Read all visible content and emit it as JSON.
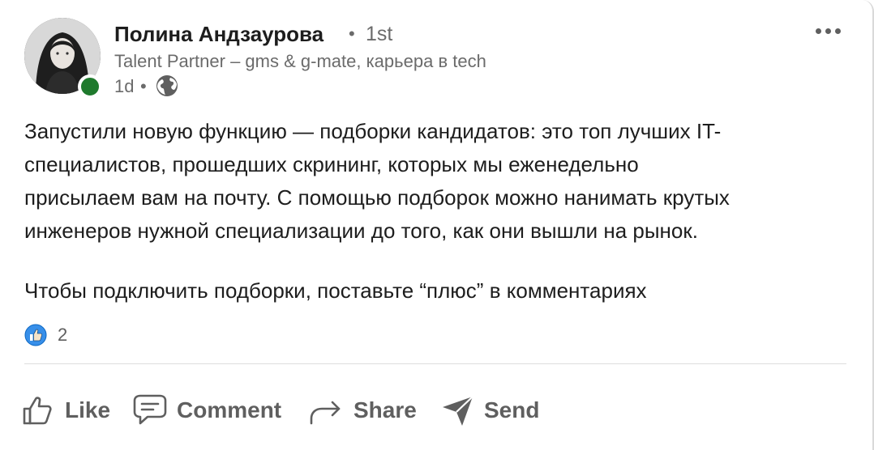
{
  "author": {
    "name": "Полина Андзаурова",
    "degree_separator": "•",
    "degree": "1st",
    "headline": "Talent Partner – gms & g-mate, карьера в tech",
    "time": "1d",
    "time_separator": "•",
    "visibility_icon": "globe-icon",
    "online_status_color": "#1f7a2d"
  },
  "post": {
    "lines": [
      "Запустили новую функцию — подборки кандидатов: это топ лучших IT-",
      "специалистов, прошедших скрининг, которых мы еженедельно",
      "присылаем вам на почту. С помощью подборок можно нанимать крутых",
      "инженеров нужной специализации до того, как они вышли на рынок."
    ],
    "cta": "Чтобы подключить подборки, поставьте “плюс” в комментариях"
  },
  "reactions": {
    "icon": "like-reaction-icon",
    "count": "2",
    "accent": "#378fe9"
  },
  "actions": {
    "like": "Like",
    "comment": "Comment",
    "share": "Share",
    "send": "Send"
  },
  "colors": {
    "text": "#1d1d1d",
    "muted": "#6b6b6b",
    "action": "#5f5f5f"
  }
}
